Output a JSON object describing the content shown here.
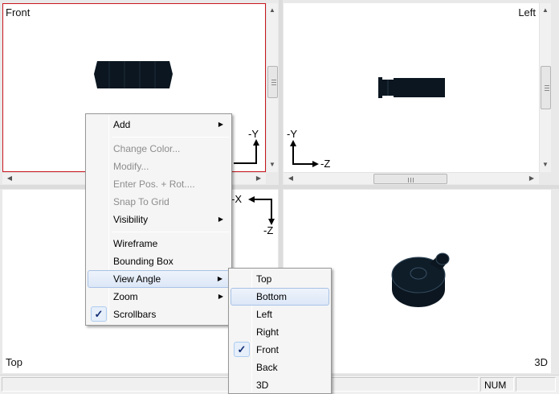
{
  "viewports": {
    "front": {
      "label": "Front"
    },
    "left": {
      "label": "Left"
    },
    "top": {
      "label": "Top"
    },
    "view3d": {
      "label": "3D"
    }
  },
  "axes": {
    "front_vertical": "-Y",
    "left_vertical": "-Y",
    "left_horizontal": "-Z",
    "top_horizontal": "-X",
    "top_vertical": "-Z"
  },
  "context_menu": {
    "items": [
      {
        "label": "Add",
        "submenu": true,
        "enabled": true
      },
      {
        "label": "Change Color...",
        "enabled": false
      },
      {
        "label": "Modify...",
        "enabled": false
      },
      {
        "label": "Enter Pos. + Rot....",
        "enabled": false
      },
      {
        "label": "Snap To Grid",
        "enabled": false
      },
      {
        "label": "Visibility",
        "submenu": true,
        "enabled": true
      },
      {
        "label": "Wireframe",
        "enabled": true
      },
      {
        "label": "Bounding Box",
        "enabled": true
      },
      {
        "label": "View Angle",
        "submenu": true,
        "enabled": true,
        "highlighted": true
      },
      {
        "label": "Zoom",
        "submenu": true,
        "enabled": true
      },
      {
        "label": "Scrollbars",
        "enabled": true,
        "checked": true
      }
    ]
  },
  "view_angle_menu": {
    "items": [
      {
        "label": "Top"
      },
      {
        "label": "Bottom",
        "highlighted": true
      },
      {
        "label": "Left"
      },
      {
        "label": "Right"
      },
      {
        "label": "Front",
        "checked": true
      },
      {
        "label": "Back"
      },
      {
        "label": "3D"
      }
    ]
  },
  "status": {
    "num": "NUM"
  },
  "colors": {
    "active_border": "#c8161d",
    "model": "#0b1620",
    "highlight": "#dce7f7"
  },
  "icons": {
    "submenu": "arrow-right-icon",
    "check": "checkmark-icon"
  }
}
